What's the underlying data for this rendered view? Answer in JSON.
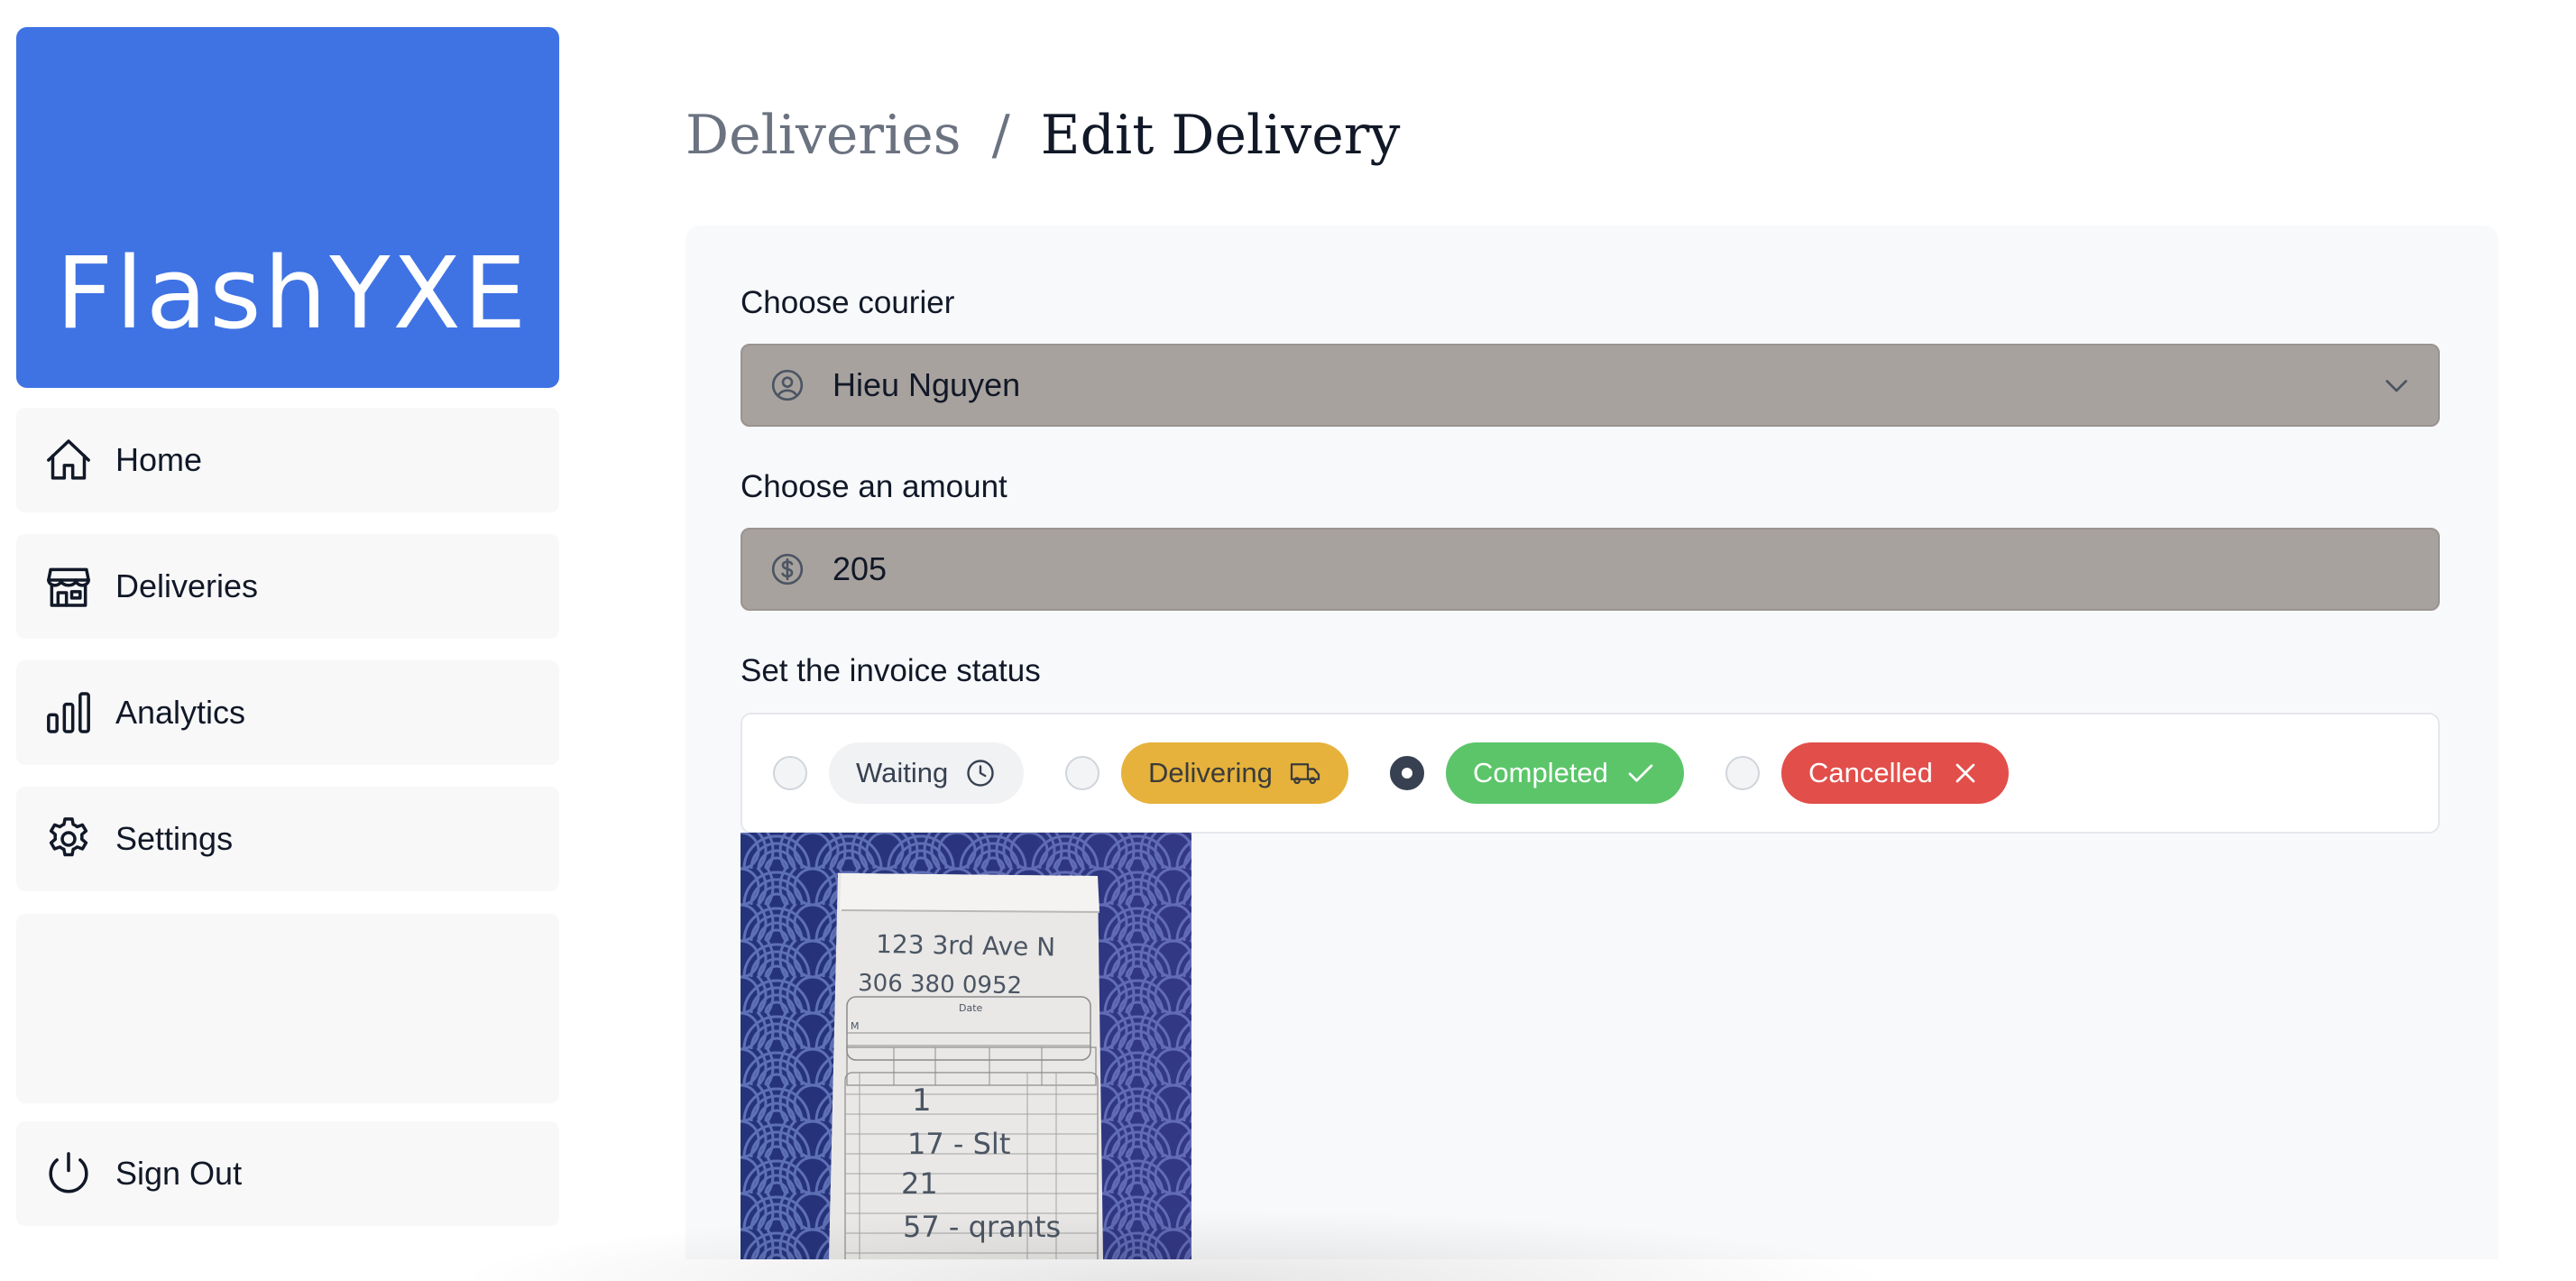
{
  "app": {
    "logo_text": "FlashYXE",
    "brand_color": "#3f73e4"
  },
  "sidebar": {
    "items": [
      {
        "label": "Home",
        "icon": "home-icon"
      },
      {
        "label": "Deliveries",
        "icon": "store-icon"
      },
      {
        "label": "Analytics",
        "icon": "bar-chart-icon"
      },
      {
        "label": "Settings",
        "icon": "gear-icon"
      }
    ],
    "sign_out": {
      "label": "Sign Out",
      "icon": "power-icon"
    }
  },
  "breadcrumb": {
    "parent": "Deliveries",
    "separator": "/",
    "current": "Edit Delivery"
  },
  "form": {
    "courier": {
      "label": "Choose courier",
      "value": "Hieu Nguyen",
      "icon": "user-circle-icon"
    },
    "amount": {
      "label": "Choose an amount",
      "value": "205",
      "icon": "dollar-circle-icon"
    },
    "status": {
      "label": "Set the invoice status",
      "options": [
        {
          "label": "Waiting",
          "icon": "clock-icon",
          "color": "#f1f2f4",
          "checked": false
        },
        {
          "label": "Delivering",
          "icon": "truck-icon",
          "color": "#e6b23c",
          "checked": false
        },
        {
          "label": "Completed",
          "icon": "check-icon",
          "color": "#5cc56a",
          "checked": true
        },
        {
          "label": "Cancelled",
          "icon": "x-icon",
          "color": "#e24e4a",
          "checked": false
        }
      ]
    }
  },
  "receipt": {
    "handwritten_lines": [
      "123 3rd Ave N",
      "306 380 0952",
      "1",
      "17 - Slt",
      "21",
      "57 - qrants"
    ],
    "printed_labels": [
      "Date",
      "M"
    ]
  }
}
